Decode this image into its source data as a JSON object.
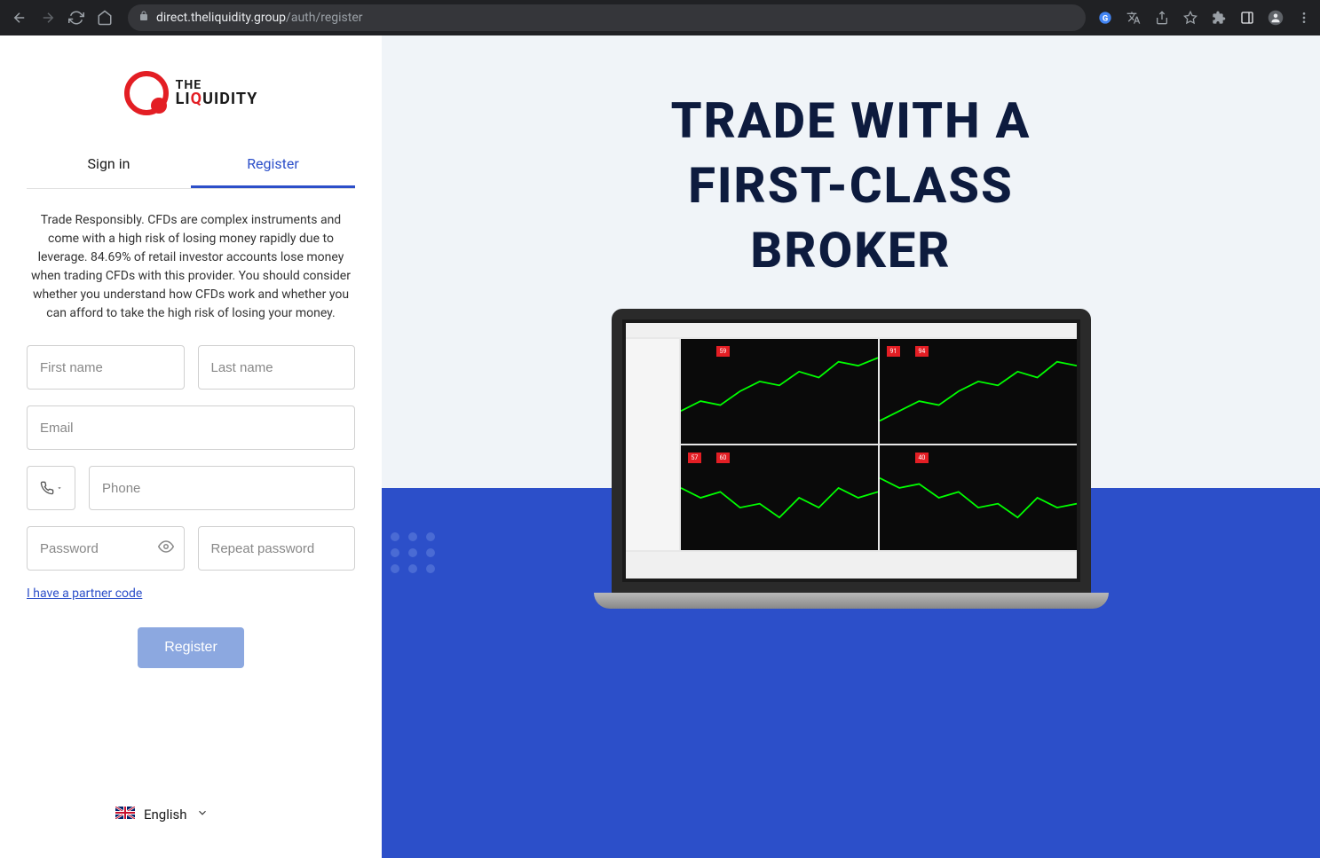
{
  "browser": {
    "url_domain": "direct.theliquidity.group",
    "url_path": "/auth/register"
  },
  "logo": {
    "line1": "THE",
    "line2_a": "LI",
    "line2_b": "Q",
    "line2_c": "UIDITY"
  },
  "tabs": {
    "signin": "Sign in",
    "register": "Register"
  },
  "disclaimer": "Trade Responsibly. CFDs are complex instruments and come with a high risk of losing money rapidly due to leverage. 84.69% of retail investor accounts lose money when trading CFDs with this provider. You should consider whether you understand how CFDs work and whether you can afford to take the high risk of losing your money.",
  "form": {
    "first_name": "First name",
    "last_name": "Last name",
    "email": "Email",
    "phone": "Phone",
    "password": "Password",
    "repeat_password": "Repeat password",
    "partner_link": "I have a partner code",
    "register_btn": "Register"
  },
  "language": {
    "current": "English"
  },
  "hero": {
    "line1": "TRADE WITH A",
    "line2": "FIRST-CLASS",
    "line3": "BROKER"
  }
}
